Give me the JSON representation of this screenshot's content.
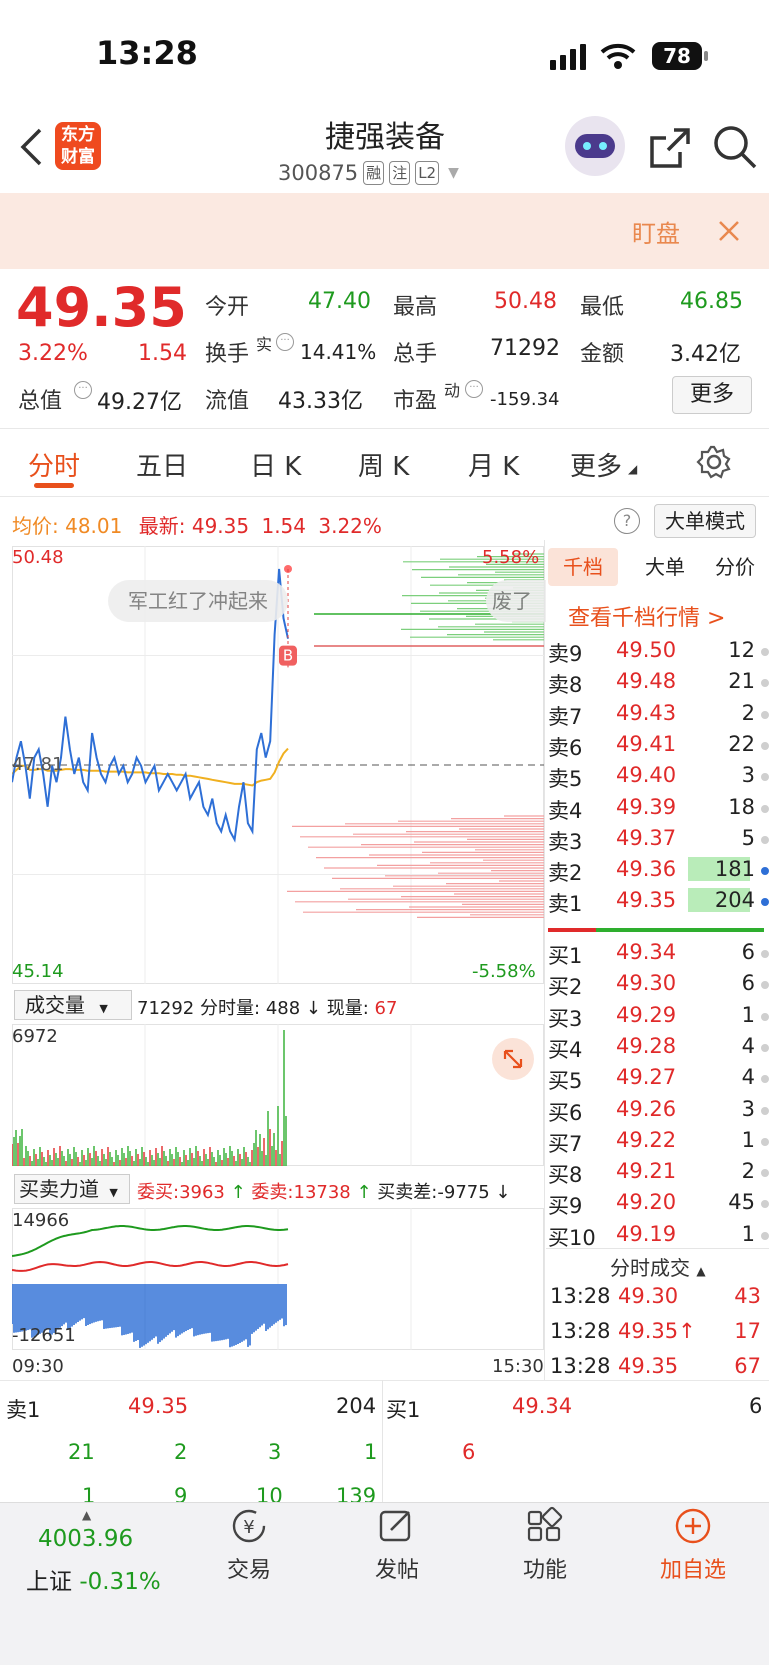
{
  "status": {
    "time": "13:28",
    "battery": "78"
  },
  "header": {
    "logo_line1": "东方",
    "logo_line2": "财富",
    "title": "捷强装备",
    "code": "300875",
    "tags": [
      "融",
      "注",
      "L2"
    ]
  },
  "banner": {
    "label": "盯盘"
  },
  "quote": {
    "price": "49.35",
    "change_pct": "3.22%",
    "change": "1.54",
    "open_label": "今开",
    "open": "47.40",
    "high_label": "最高",
    "high": "50.48",
    "low_label": "最低",
    "low": "46.85",
    "turnover_label": "换手",
    "turnover_sup": "实",
    "turnover": "14.41%",
    "volume_label": "总手",
    "volume": "71292",
    "amount_label": "金额",
    "amount": "3.42亿",
    "mktcap_label": "总值",
    "mktcap": "49.27亿",
    "float_label": "流值",
    "float": "43.33亿",
    "pe_label": "市盈",
    "pe_sup": "动",
    "pe": "-159.34",
    "more": "更多"
  },
  "tabs": [
    "分时",
    "五日",
    "日 K",
    "周 K",
    "月 K",
    "更多"
  ],
  "info_bar": {
    "avg_label": "均价:",
    "avg": "48.01",
    "last_label": "最新:",
    "last": "49.35",
    "chg": "1.54",
    "pct": "3.22%",
    "mode_button": "大单模式"
  },
  "chart_data": {
    "type": "line",
    "ylim": [
      45.14,
      50.48
    ],
    "y_top": "50.48",
    "y_bottom": "45.14",
    "y_mid": "47.81",
    "pct_top": "5.58%",
    "pct_bottom": "-5.58%",
    "x_start": "09:30",
    "x_end": "15:30",
    "series": [
      {
        "name": "最新",
        "color": "#2e6fd6",
        "values": [
          47.6,
          47.9,
          48.1,
          47.8,
          47.4,
          47.9,
          48.0,
          47.7,
          47.3,
          47.8,
          47.6,
          47.9,
          48.4,
          48.0,
          47.7,
          47.9,
          47.6,
          47.5,
          48.2,
          47.9,
          47.7,
          47.6,
          47.8,
          47.9,
          47.7,
          47.8,
          47.6,
          47.7,
          47.9,
          47.8,
          47.6,
          47.7,
          47.8,
          47.5,
          47.6,
          47.7,
          47.6,
          47.5,
          47.6,
          47.7,
          47.4,
          47.5,
          47.6,
          47.3,
          47.2,
          47.4,
          47.1,
          47.0,
          47.2,
          47.0,
          46.9,
          47.3,
          47.6,
          47.1,
          47.0,
          48.0,
          48.2,
          47.9,
          48.1,
          49.4,
          50.2,
          49.6,
          49.35
        ]
      },
      {
        "name": "均价",
        "color": "#f0b020",
        "values": [
          47.7,
          47.75,
          47.8,
          47.8,
          47.75,
          47.75,
          47.76,
          47.76,
          47.74,
          47.74,
          47.74,
          47.75,
          47.76,
          47.76,
          47.75,
          47.75,
          47.75,
          47.74,
          47.74,
          47.74,
          47.74,
          47.73,
          47.73,
          47.73,
          47.73,
          47.73,
          47.72,
          47.72,
          47.72,
          47.72,
          47.72,
          47.71,
          47.71,
          47.71,
          47.7,
          47.7,
          47.7,
          47.69,
          47.69,
          47.68,
          47.68,
          47.67,
          47.66,
          47.65,
          47.64,
          47.63,
          47.62,
          47.61,
          47.6,
          47.59,
          47.58,
          47.58,
          47.58,
          47.57,
          47.56,
          47.6,
          47.62,
          47.63,
          47.64,
          47.72,
          47.85,
          47.95,
          48.01
        ]
      }
    ]
  },
  "chart_bubble": {
    "left": "军工红了冲起来",
    "right": "废了"
  },
  "volume": {
    "label": "成交量",
    "total": "71292",
    "minute_label": "分时量:",
    "minute": "488",
    "now_label": "现量:",
    "now": "67",
    "max": "6972"
  },
  "force": {
    "label": "买卖力道",
    "buy_label": "委买:",
    "buy": "3963",
    "sell_label": "委卖:",
    "sell": "13738",
    "diff_label": "买卖差:",
    "diff": "-9775",
    "top": "14966",
    "bottom": "-12651"
  },
  "orderbook": {
    "tabs": [
      "千档",
      "大单",
      "分价"
    ],
    "link": "查看千档行情 >",
    "asks": [
      {
        "label": "卖9",
        "price": "49.50",
        "qty": "12"
      },
      {
        "label": "卖8",
        "price": "49.48",
        "qty": "21"
      },
      {
        "label": "卖7",
        "price": "49.43",
        "qty": "2"
      },
      {
        "label": "卖6",
        "price": "49.41",
        "qty": "22"
      },
      {
        "label": "卖5",
        "price": "49.40",
        "qty": "3"
      },
      {
        "label": "卖4",
        "price": "49.39",
        "qty": "18"
      },
      {
        "label": "卖3",
        "price": "49.37",
        "qty": "5"
      },
      {
        "label": "卖2",
        "price": "49.36",
        "qty": "181"
      },
      {
        "label": "卖1",
        "price": "49.35",
        "qty": "204"
      }
    ],
    "bids": [
      {
        "label": "买1",
        "price": "49.34",
        "qty": "6"
      },
      {
        "label": "买2",
        "price": "49.30",
        "qty": "6"
      },
      {
        "label": "买3",
        "price": "49.29",
        "qty": "1"
      },
      {
        "label": "买4",
        "price": "49.28",
        "qty": "4"
      },
      {
        "label": "买5",
        "price": "49.27",
        "qty": "4"
      },
      {
        "label": "买6",
        "price": "49.26",
        "qty": "3"
      },
      {
        "label": "买7",
        "price": "49.22",
        "qty": "1"
      },
      {
        "label": "买8",
        "price": "49.21",
        "qty": "2"
      },
      {
        "label": "买9",
        "price": "49.20",
        "qty": "45"
      },
      {
        "label": "买10",
        "price": "49.19",
        "qty": "1"
      }
    ],
    "trades_title": "分时成交",
    "trades": [
      {
        "time": "13:28",
        "price": "49.30",
        "qty": "43"
      },
      {
        "time": "13:28",
        "price": "49.35↑",
        "qty": "17"
      },
      {
        "time": "13:28",
        "price": "49.35",
        "qty": "67"
      }
    ]
  },
  "queue": {
    "sell_label": "卖1",
    "sell_price": "49.35",
    "sell_qty": "204",
    "buy_label": "买1",
    "buy_price": "49.34",
    "buy_qty": "6",
    "sell_row1": [
      "21",
      "2",
      "3",
      "1"
    ],
    "sell_row2": [
      "1",
      "9",
      "10",
      "139"
    ],
    "buy_row1": [
      "6"
    ]
  },
  "bottom": {
    "index_value": "4003.96",
    "index_name": "上证",
    "index_pct": "-0.31%",
    "nav": [
      "交易",
      "发帖",
      "功能",
      "加自选"
    ]
  }
}
